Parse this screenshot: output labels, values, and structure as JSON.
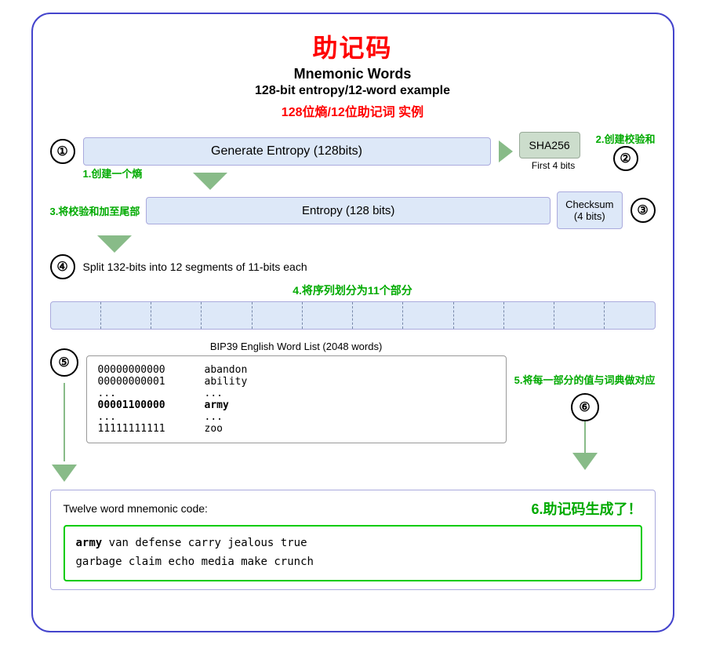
{
  "title": {
    "zh": "助记码",
    "en1": "Mnemonic Words",
    "en2": "128-bit entropy/12-word example",
    "subtitle_zh": "128位熵/12位助记词 实例"
  },
  "step1": {
    "circle": "①",
    "label": "1.创建一个熵",
    "entropy_label": "Generate Entropy (128bits)"
  },
  "step2": {
    "circle": "②",
    "label": "2.创建校验和",
    "sha256": "SHA256",
    "first4bits": "First 4 bits"
  },
  "step3": {
    "label": "3.将校验和加至尾部",
    "entropy_label": "Entropy (128 bits)",
    "checksum_label": "Checksum\n(4 bits)",
    "circle": "③"
  },
  "step4": {
    "circle": "④",
    "text": "Split 132-bits into 12 segments of 11-bits each",
    "label_zh": "4.将序列划分为11个部分",
    "segments": 12
  },
  "step5": {
    "circle": "⑤",
    "label": "5.将每一部分的值与词典做对应",
    "bip39_title": "BIP39 English Word List (2048 words)",
    "rows": [
      {
        "code": "00000000000",
        "word": "abandon"
      },
      {
        "code": "00000000001",
        "word": "ability"
      },
      {
        "code": "...",
        "word": "..."
      },
      {
        "code": "00001100000",
        "word": "army",
        "highlight": true
      },
      {
        "code": "...",
        "word": "..."
      },
      {
        "code": "11111111111",
        "word": "zoo"
      }
    ]
  },
  "step6": {
    "circle": "⑥",
    "label": "6.助记码生成了！",
    "mnemonic_label": "Twelve word mnemonic code:",
    "mnemonic_words": "army van defense carry jealous true garbage claim echo media make crunch",
    "first_word": "army"
  }
}
